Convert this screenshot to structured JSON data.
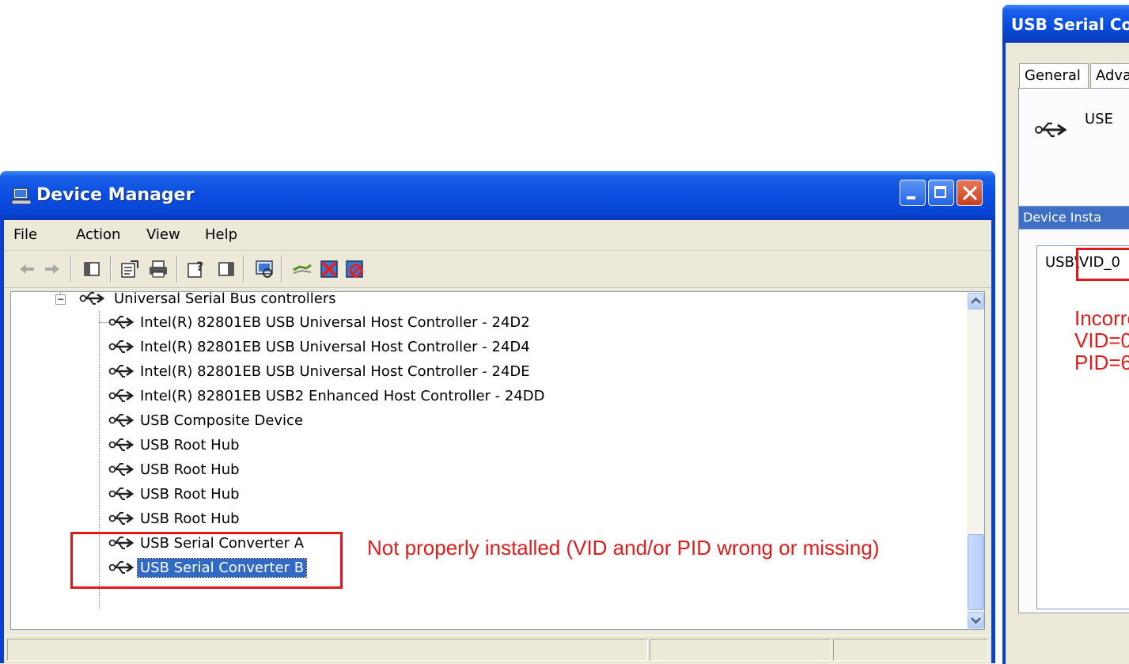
{
  "device_manager": {
    "title": "Device Manager",
    "menu": [
      "File",
      "Action",
      "View",
      "Help"
    ],
    "tree": {
      "root_label": "Universal Serial Bus controllers",
      "children": [
        "Intel(R) 82801EB USB Universal Host Controller - 24D2",
        "Intel(R) 82801EB USB Universal Host Controller - 24D4",
        "Intel(R) 82801EB USB Universal Host Controller - 24DE",
        "Intel(R) 82801EB USB2 Enhanced Host Controller - 24DD",
        "USB Composite Device",
        "USB Root Hub",
        "USB Root Hub",
        "USB Root Hub",
        "USB Root Hub",
        "USB Serial Converter A",
        "USB Serial Converter B"
      ],
      "selected": "USB Serial Converter B"
    },
    "annotation": "Not properly installed (VID and/or PID wrong or missing)",
    "colors": {
      "annotation": "#e01c1c",
      "selection": "#316ac5",
      "titlebar": "#0a4de0"
    },
    "toolbar_icons": [
      "back-arrow-icon",
      "forward-arrow-icon",
      "show-hide-tree-icon",
      "properties-icon",
      "print-icon",
      "help-icon",
      "show-pane-icon",
      "scan-hardware-icon",
      "update-driver-icon",
      "uninstall-icon",
      "disable-icon"
    ]
  },
  "properties_window": {
    "title": "USB Serial Co",
    "tabs": [
      "General",
      "Adva"
    ],
    "device_name": "USE",
    "property_select": "Device Insta",
    "value_text": "USB\\VID_0",
    "annotation_lines": [
      "Incorre",
      "VID=0",
      "PID=6"
    ]
  }
}
